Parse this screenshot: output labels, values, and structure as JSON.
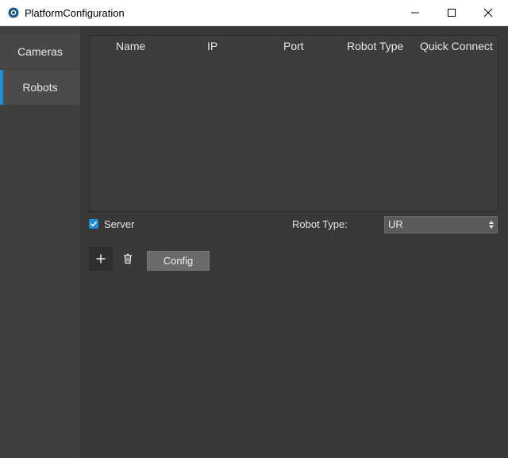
{
  "window": {
    "title": "PlatformConfiguration",
    "icons": {
      "app": "eye-logo-icon",
      "minimize": "minimize-icon",
      "maximize": "maximize-icon",
      "close": "close-icon"
    }
  },
  "sidebar": {
    "items": [
      {
        "label": "Cameras",
        "selected": false
      },
      {
        "label": "Robots",
        "selected": true
      }
    ],
    "accent_color": "#1e8fd6"
  },
  "robots_table": {
    "columns": [
      "Name",
      "IP",
      "Port",
      "Robot Type",
      "Quick Connect"
    ],
    "rows": []
  },
  "server": {
    "label": "Server",
    "checked": true
  },
  "robot_type": {
    "label": "Robot Type:",
    "selected": "UR"
  },
  "actions": {
    "add_icon": "plus-icon",
    "delete_icon": "trash-icon",
    "config_label": "Config"
  }
}
